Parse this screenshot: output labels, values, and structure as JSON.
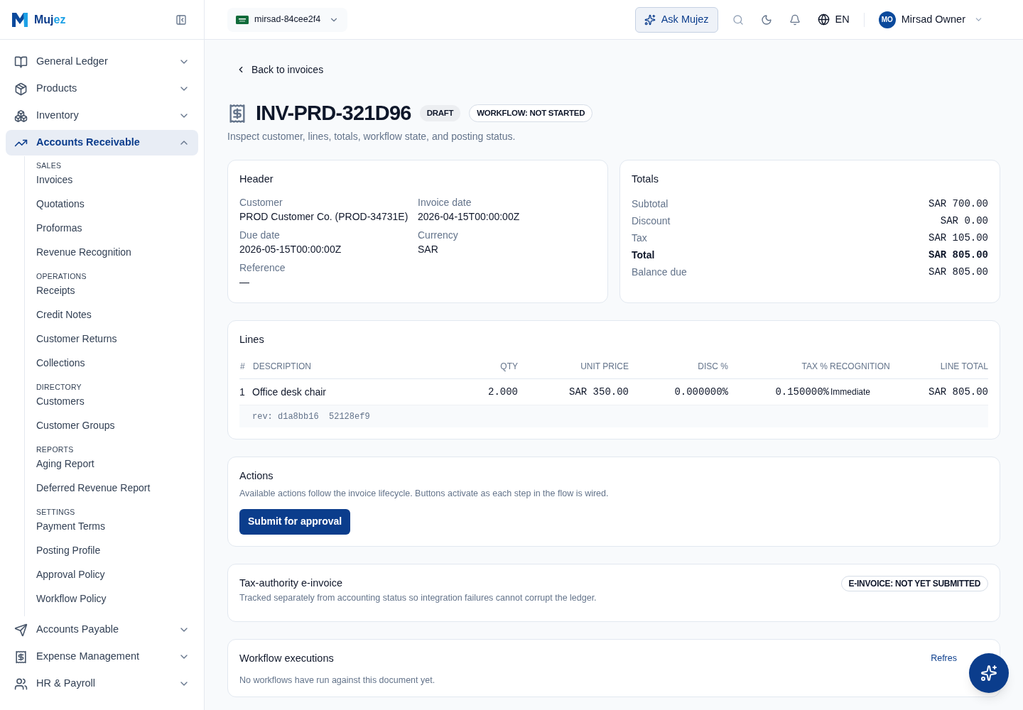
{
  "brand": {
    "name_part_1": "Muj",
    "name_part_2": "ez"
  },
  "sidebar": {
    "groups": [
      {
        "label": "General Ledger",
        "expanded": false,
        "selected": false
      },
      {
        "label": "Products",
        "expanded": false,
        "selected": false
      },
      {
        "label": "Inventory",
        "expanded": false,
        "selected": false
      },
      {
        "label": "Accounts Receivable",
        "expanded": true,
        "selected": true,
        "sections": [
          {
            "heading": "SALES",
            "items": [
              "Invoices",
              "Quotations",
              "Proformas",
              "Revenue Recognition"
            ]
          },
          {
            "heading": "OPERATIONS",
            "items": [
              "Receipts",
              "Credit Notes",
              "Customer Returns",
              "Collections"
            ]
          },
          {
            "heading": "DIRECTORY",
            "items": [
              "Customers",
              "Customer Groups"
            ]
          },
          {
            "heading": "REPORTS",
            "items": [
              "Aging Report",
              "Deferred Revenue Report"
            ]
          },
          {
            "heading": "SETTINGS",
            "items": [
              "Payment Terms",
              "Posting Profile",
              "Approval Policy",
              "Workflow Policy"
            ]
          }
        ]
      },
      {
        "label": "Accounts Payable",
        "expanded": false,
        "selected": false
      },
      {
        "label": "Expense Management",
        "expanded": false,
        "selected": false
      },
      {
        "label": "HR & Payroll",
        "expanded": false,
        "selected": false
      }
    ]
  },
  "topbar": {
    "tenant": "mirsad-84cee2f4",
    "ask_button": "Ask Mujez",
    "language": "EN",
    "user": {
      "initials": "MO",
      "name": "Mirsad Owner"
    }
  },
  "page": {
    "back_link": "Back to invoices",
    "title": "INV-PRD-321D96",
    "badges": [
      "DRAFT",
      "WORKFLOW: NOT STARTED"
    ],
    "subtitle": "Inspect customer, lines, totals, workflow state, and posting status."
  },
  "header_card": {
    "title": "Header",
    "fields": [
      {
        "label": "Customer",
        "value": "PROD Customer Co. (PROD-34731E)"
      },
      {
        "label": "Invoice date",
        "value": "2026-04-15T00:00:00Z"
      },
      {
        "label": "Due date",
        "value": "2026-05-15T00:00:00Z"
      },
      {
        "label": "Currency",
        "value": "SAR"
      },
      {
        "label": "Reference",
        "value": "—"
      }
    ]
  },
  "totals_card": {
    "title": "Totals",
    "rows": [
      {
        "label": "Subtotal",
        "value": "SAR 700.00",
        "emphasis": false
      },
      {
        "label": "Discount",
        "value": "SAR 0.00",
        "emphasis": false
      },
      {
        "label": "Tax",
        "value": "SAR 105.00",
        "emphasis": false
      },
      {
        "label": "Total",
        "value": "SAR 805.00",
        "emphasis": true
      },
      {
        "label": "Balance due",
        "value": "SAR 805.00",
        "emphasis": false
      }
    ]
  },
  "lines_card": {
    "title": "Lines",
    "columns": [
      "#",
      "DESCRIPTION",
      "QTY",
      "UNIT PRICE",
      "DISC %",
      "TAX %",
      "RECOGNITION",
      "LINE TOTAL"
    ],
    "rows": [
      {
        "number": "1",
        "description": "Office desk chair",
        "qty": "2.000",
        "unit_price": "SAR 350.00",
        "disc": "0.000000%",
        "tax": "0.150000%",
        "recognition": "Immediate",
        "line_total": "SAR 805.00",
        "revision": "rev: d1a8bb16  52128ef9"
      }
    ]
  },
  "actions_card": {
    "title": "Actions",
    "description": "Available actions follow the invoice lifecycle. Buttons activate as each step in the flow is wired.",
    "buttons": [
      "Submit for approval"
    ]
  },
  "einvoice_card": {
    "title": "Tax-authority e-invoice",
    "description": "Tracked separately from accounting status so integration failures cannot corrupt the ledger.",
    "badge": "E-INVOICE: NOT YET SUBMITTED"
  },
  "workflow_card": {
    "title": "Workflow executions",
    "refresh_link": "Refres",
    "empty_text": "No workflows have run against this document yet."
  }
}
